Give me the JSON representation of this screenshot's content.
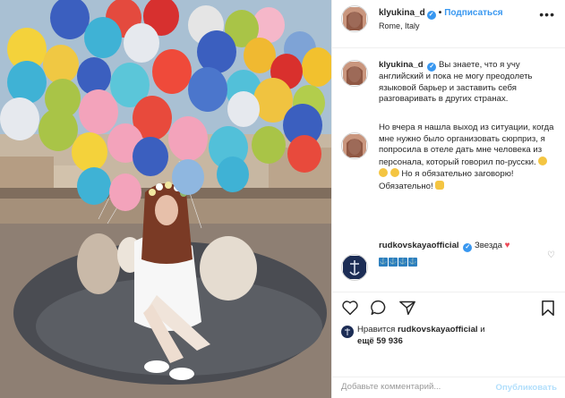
{
  "post": {
    "username": "klyukina_d",
    "follow_label": "Подписаться",
    "location": "Rome, Italy"
  },
  "comments": [
    {
      "username": "klyukina_d",
      "text": "Вы знаете, что я учу английский и пока не могу преодолеть языковой барьер и заставить себя разговаривать в других странах."
    },
    {
      "username": "",
      "text_before": "Но вчера я нашла выход из ситуации, когда мне нужно было организовать сюрприз, я попросила в отеле дать мне человека из персонала, который говорил по-русски.",
      "text_after": "Но я обязательно заговорю! Обязательно!"
    },
    {
      "username": "rudkovskayaofficial",
      "text": "Звезда"
    }
  ],
  "likes": {
    "prefix": "Нравится",
    "user": "rudkovskayaofficial",
    "and": "и",
    "more": "ещё 59 936"
  },
  "add_comment": {
    "placeholder": "Добавьте комментарий...",
    "publish_label": "Опубликовать"
  },
  "icons": {
    "like": "heart-outline-icon",
    "comment": "speech-bubble-icon",
    "share": "paper-plane-icon",
    "save": "bookmark-icon",
    "more": "ellipsis-icon"
  },
  "colors": {
    "link_blue": "#3897f0",
    "heart_red": "#ed4956",
    "publish_disabled": "#b2dffc"
  }
}
